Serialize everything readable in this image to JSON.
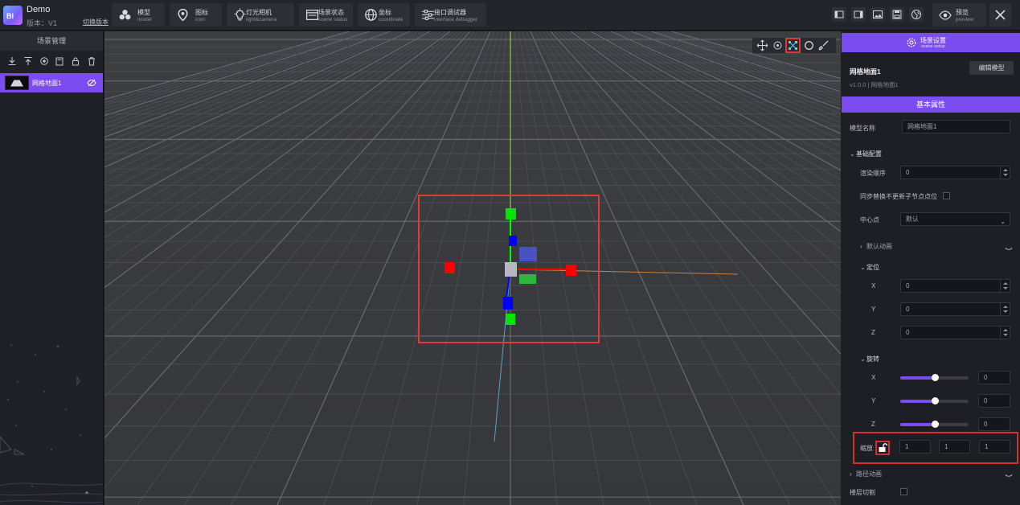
{
  "app": {
    "title": "Demo",
    "version": "版本：V1",
    "switch_version": "切换版本",
    "logo_text": "BI"
  },
  "toolbar": {
    "items": [
      {
        "cn": "模型",
        "en": "model",
        "icon": "cubes-icon"
      },
      {
        "cn": "图标",
        "en": "icon",
        "icon": "map-pin-icon"
      },
      {
        "cn": "灯光相机",
        "en": "light&camera",
        "icon": "bulb-icon"
      },
      {
        "cn": "场景状态",
        "en": "scene status",
        "icon": "window-icon"
      },
      {
        "cn": "坐标",
        "en": "coordinate",
        "icon": "globe-icon"
      },
      {
        "cn": "接口调试器",
        "en": "interface debugger",
        "icon": "sliders-icon"
      }
    ],
    "preview": {
      "cn": "预览",
      "en": "preview"
    }
  },
  "left_panel": {
    "title": "场景管理",
    "tools": [
      "download-icon",
      "upload-top-icon",
      "target-icon",
      "copy-icon",
      "lock-icon",
      "trash-icon"
    ],
    "items": [
      {
        "name": "网格地面1"
      }
    ]
  },
  "viewport": {
    "tools": [
      "move-icon",
      "rotate-icon",
      "scale-icon",
      "circle-icon",
      "brush-icon"
    ],
    "active_tool": "scale-icon",
    "colors": {
      "grid_bg": "#3a3b3f",
      "x_axis": "#ff0000",
      "y_axis": "#00ff00",
      "z_axis": "#0000ff",
      "selection": "#d32f2f"
    }
  },
  "right_panel": {
    "scene_setup": {
      "cn": "场景设置",
      "en": "scene setup"
    },
    "model_name": "网格地面1",
    "model_meta": "v1.0.0 | 网格地面1",
    "edit_model": "编辑模型",
    "basic_attr": "基本属性",
    "fields": {
      "model_name_label": "模型名称",
      "model_name_value": "网格地面1",
      "basic_config": "基础配置",
      "render_order_label": "渲染顺序",
      "render_order_value": "0",
      "sync_label": "同步替换不更新子节点点位",
      "center_label": "中心点",
      "center_value": "默认",
      "default_anim": "默认动画",
      "position": "定位",
      "pos_x_label": "X",
      "pos_x": "0",
      "pos_y_label": "Y",
      "pos_y": "0",
      "pos_z_label": "Z",
      "pos_z": "0",
      "rotation": "旋转",
      "rot_x_label": "X",
      "rot_x": "0",
      "rot_y_label": "Y",
      "rot_y": "0",
      "rot_z_label": "Z",
      "rot_z": "0",
      "scale_label": "缩放",
      "scale_x": "1",
      "scale_y": "1",
      "scale_z": "1",
      "path_anim": "路径动画",
      "layer_clip": "楼层切割"
    },
    "rotation_slider_fraction": 0.5
  }
}
